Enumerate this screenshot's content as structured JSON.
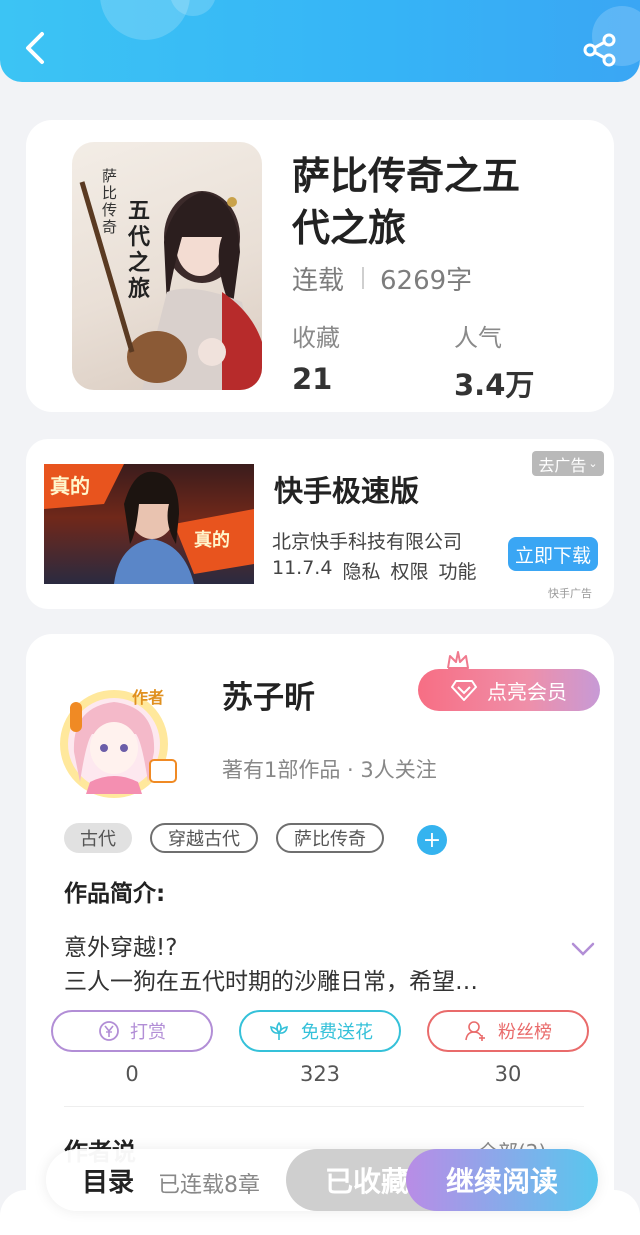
{
  "book": {
    "title_line1": "萨比传奇之五",
    "title_line2": "代之旅",
    "status": "连载",
    "word_count": "6269字",
    "favorites_label": "收藏",
    "favorites_value": "21",
    "popularity_label": "人气",
    "popularity_value": "3.4万",
    "cover": {
      "vertical_text_1": "萨比传奇",
      "vertical_text_2": "五代之旅"
    }
  },
  "ad": {
    "app_name": "快手极速版",
    "company": "北京快手科技有限公司",
    "version": "11.7.4",
    "privacy": "隐私",
    "permissions": "权限",
    "features": "功能",
    "close_label": "去广告",
    "download_label": "立即下载",
    "source": "快手广告",
    "image_text_1": "真的",
    "image_text_2": "真的"
  },
  "author": {
    "badge": "作者",
    "name": "苏子昕",
    "vip_label": "点亮会员",
    "meta": "著有1部作品 · 3人关注"
  },
  "tags": [
    "古代",
    "穿越古代",
    "萨比传奇"
  ],
  "tag_add_symbol": "+",
  "intro": {
    "heading": "作品简介:",
    "line1": "意外穿越!?",
    "line2": "三人一狗在五代时期的沙雕日常，希望…"
  },
  "actions": [
    {
      "label": "打赏",
      "count": "0",
      "color": "#b28ed6"
    },
    {
      "label": "免费送花",
      "count": "323",
      "color": "#35c1d9"
    },
    {
      "label": "粉丝榜",
      "count": "30",
      "color": "#e96b6b"
    }
  ],
  "next_section": {
    "title": "作者说",
    "more": "全部(2)"
  },
  "bottom": {
    "catalog": "目录",
    "serial_info": "已连载8章",
    "collected": "已收藏",
    "continue": "继续阅读"
  },
  "colors": {
    "accent_blue": "#36b4f6",
    "vip_pink": "#f76e84",
    "continue_purple": "#b98ce6"
  }
}
